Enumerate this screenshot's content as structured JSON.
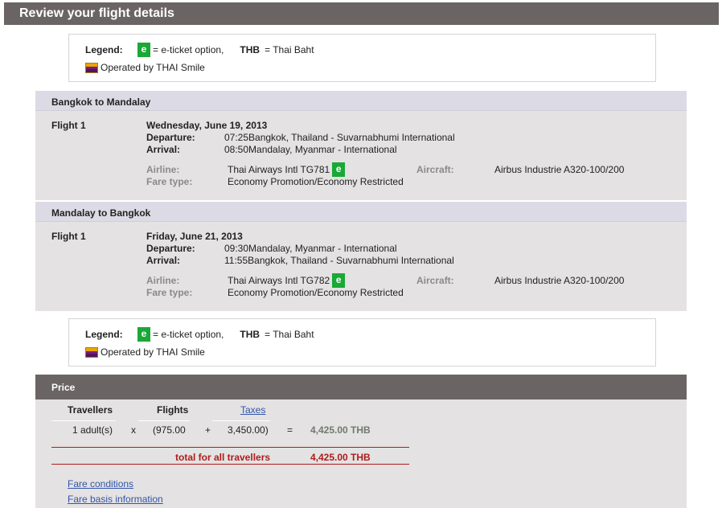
{
  "page_title": "Review your flight details",
  "legend": {
    "label": "Legend:",
    "e_icon": "e",
    "eticket_text": "= e-ticket option,",
    "thb_abbr": "THB",
    "thb_text": "= Thai Baht",
    "operated_by": "Operated by THAI Smile"
  },
  "labels": {
    "departure": "Departure:",
    "arrival": "Arrival:",
    "airline": "Airline:",
    "fare_type": "Fare type:",
    "aircraft": "Aircraft:"
  },
  "segments": [
    {
      "route": "Bangkok to Mandalay",
      "flight_no": "Flight 1",
      "date": "Wednesday, June 19, 2013",
      "departure": "07:25Bangkok, Thailand - Suvarnabhumi International",
      "arrival": "08:50Mandalay, Myanmar - International",
      "airline": "Thai Airways Intl TG781",
      "fare_type": "Economy Promotion/Economy Restricted",
      "aircraft": "Airbus Industrie A320-100/200"
    },
    {
      "route": "Mandalay to Bangkok",
      "flight_no": "Flight 1",
      "date": "Friday, June 21, 2013",
      "departure": "09:30Mandalay, Myanmar - International",
      "arrival": "11:55Bangkok, Thailand - Suvarnabhumi International",
      "airline": "Thai Airways Intl TG782",
      "fare_type": "Economy Promotion/Economy Restricted",
      "aircraft": "Airbus Industrie A320-100/200"
    }
  ],
  "price": {
    "header": "Price",
    "col_travellers": "Travellers",
    "col_flights": "Flights",
    "col_taxes": "Taxes",
    "travellers": "1 adult(s)",
    "times": "x",
    "fare": "(975.00",
    "plus": "+",
    "taxes": "3,450.00)",
    "equals": "=",
    "subtotal": "4,425.00 THB",
    "total_label": "total for all travellers",
    "total_value": "4,425.00 THB"
  },
  "links": {
    "fare_conditions": "Fare conditions",
    "fare_basis": "Fare basis information"
  },
  "colors": {
    "header_bg": "#6b6465",
    "eticket_green": "#1aa836",
    "total_red": "#b01c1c",
    "link_blue": "#3355aa"
  }
}
